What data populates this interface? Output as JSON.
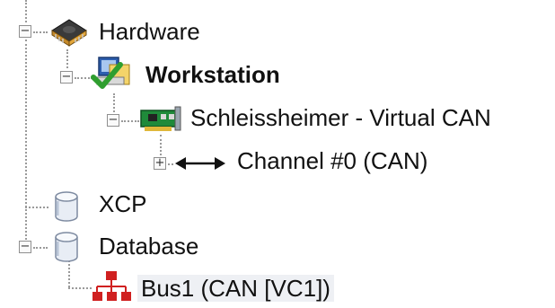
{
  "tree": {
    "hardware": {
      "label": "Hardware",
      "icon": "chip-icon",
      "expanded": true
    },
    "workstation": {
      "label": "Workstation",
      "icon": "workstation-check-icon",
      "expanded": true,
      "bold": true
    },
    "device": {
      "label": "Schleissheimer - Virtual CAN",
      "icon": "network-card-icon",
      "expanded": true
    },
    "channel": {
      "label": "Channel #0 (CAN)",
      "icon": "double-arrow-icon",
      "expanded": false
    },
    "xcp": {
      "label": "XCP",
      "icon": "database-icon"
    },
    "database": {
      "label": "Database",
      "icon": "database-icon",
      "expanded": true
    },
    "bus": {
      "label": "Bus1 (CAN [VC1])",
      "icon": "network-topology-icon",
      "selected": true
    }
  },
  "colors": {
    "connector": "#9a9a9a",
    "selection": "#eef0f4",
    "checkmark": "#2f9e2f",
    "network_red": "#d02020"
  }
}
